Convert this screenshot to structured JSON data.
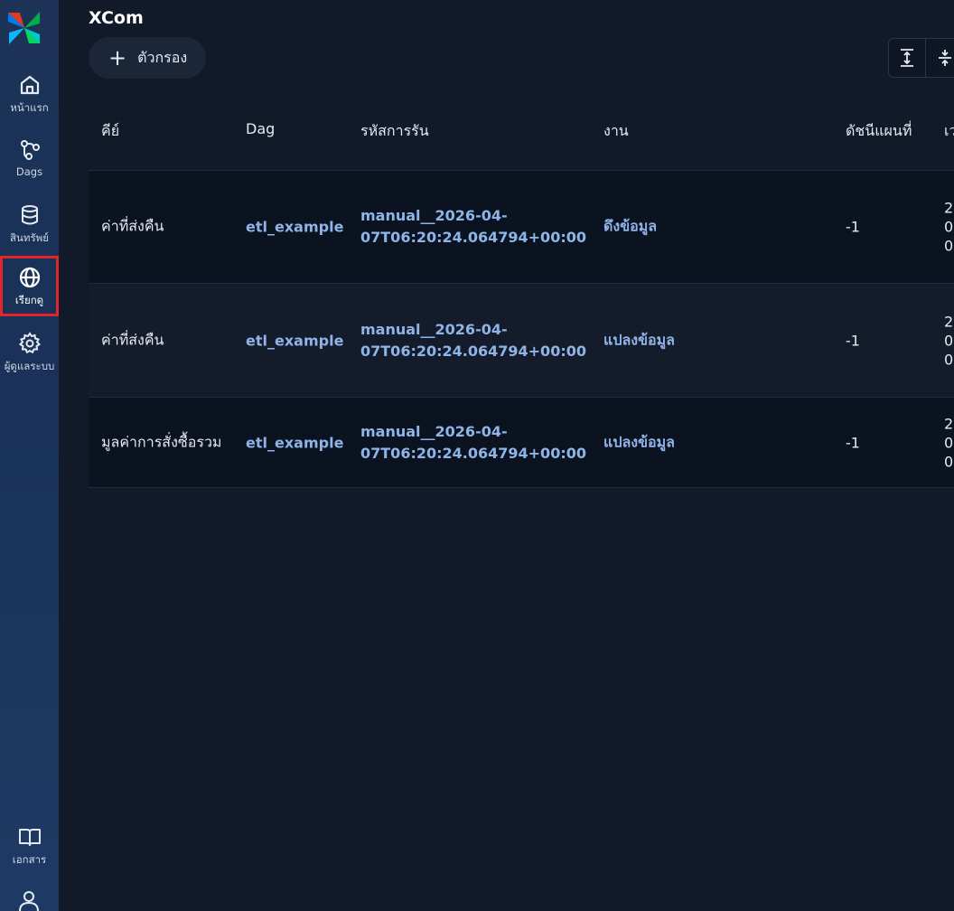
{
  "sidebar": {
    "items": [
      {
        "label": "หน้าแรก",
        "icon": "home-icon"
      },
      {
        "label": "Dags",
        "icon": "dags-icon"
      },
      {
        "label": "สินทรัพย์",
        "icon": "database-icon"
      },
      {
        "label": "เรียกดู",
        "icon": "globe-icon",
        "active": true
      },
      {
        "label": "ผู้ดูแลระบบ",
        "icon": "gear-icon"
      },
      {
        "label": "เอกสาร",
        "icon": "book-icon"
      }
    ]
  },
  "page": {
    "title": "XCom",
    "filter_label": "ตัวกรอง"
  },
  "table": {
    "headers": [
      "คีย์",
      "Dag",
      "รหัสการรัน",
      "งาน",
      "ดัชนีแผนที่",
      "เว"
    ],
    "rows": [
      {
        "key": "ค่าที่ส่งคืน",
        "dag": "etl_example",
        "run_id_line1": "manual__2026-04-",
        "run_id_line2": "07T06:20:24.064794+00:00",
        "task": "ดึงข้อมูล",
        "map_index": "-1",
        "time_lines": [
          "2",
          "0",
          "0"
        ]
      },
      {
        "key": "ค่าที่ส่งคืน",
        "dag": "etl_example",
        "run_id_line1": "manual__2026-04-",
        "run_id_line2": "07T06:20:24.064794+00:00",
        "task": "แปลงข้อมูล",
        "map_index": "-1",
        "time_lines": [
          "2",
          "0",
          "0"
        ]
      },
      {
        "key": "มูลค่าการสั่งซื้อรวม",
        "dag": "etl_example",
        "run_id_line1": "manual__2026-04-",
        "run_id_line2": "07T06:20:24.064794+00:00",
        "task": "แปลงข้อมูล",
        "map_index": "-1",
        "time_lines": [
          "2",
          "0",
          "0"
        ]
      }
    ]
  },
  "colors": {
    "accent_link": "#8fb4e8",
    "active_outline": "#e0262b",
    "sidebar_bg": "#1c3357",
    "main_bg": "#121a2a"
  }
}
